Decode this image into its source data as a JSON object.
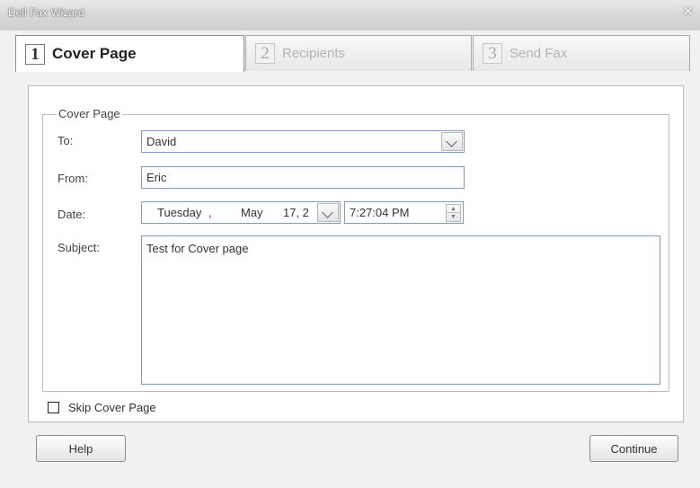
{
  "window": {
    "title": "Dell Fax Wizard",
    "close_glyph": "✕"
  },
  "tabs": [
    {
      "number": "1",
      "label": "Cover Page",
      "state": "active"
    },
    {
      "number": "2",
      "label": "Recipients",
      "state": "inactive"
    },
    {
      "number": "3",
      "label": "Send Fax",
      "state": "inactive"
    }
  ],
  "cover_page": {
    "group_label": "Cover Page",
    "to": {
      "label": "To:",
      "value": "David"
    },
    "from": {
      "label": "From:",
      "value": "Eric"
    },
    "date": {
      "label": "Date:",
      "weekday": "Tuesday",
      "sep": ",",
      "month": "May",
      "day_year": "17, 2",
      "time": "7:27:04 PM"
    },
    "subject": {
      "label": "Subject:",
      "value": "Test for Cover page"
    }
  },
  "skip_cover": {
    "label": "Skip Cover Page",
    "checked": false
  },
  "buttons": {
    "help": "Help",
    "continue": "Continue"
  },
  "icons": {
    "dropdown": "chevron-down-icon",
    "spin": "spin-updown-icon",
    "close": "close-icon"
  }
}
